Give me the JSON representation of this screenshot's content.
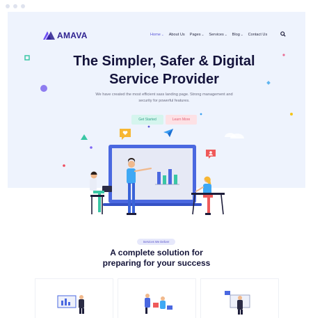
{
  "brand": {
    "logo_text": "AMAVA",
    "accent": "#5b57d9",
    "logo_color": "#2c1f8f"
  },
  "nav": {
    "items": [
      {
        "label": "Home",
        "dropdown": true,
        "active": true
      },
      {
        "label": "About Us",
        "dropdown": false
      },
      {
        "label": "Pages",
        "dropdown": true
      },
      {
        "label": "Services",
        "dropdown": true
      },
      {
        "label": "Blog",
        "dropdown": true
      },
      {
        "label": "Contact Us",
        "dropdown": false
      }
    ],
    "search_icon": "search-icon"
  },
  "hero": {
    "title_line1": "The Simpler, Safer & Digital",
    "title_line2": "Service Provider",
    "subtitle": "We have created the most efficient sass landing page. Strong management and security for powerful features.",
    "primary_button": "Get Started",
    "secondary_button": "Learn More",
    "background": "#eef3fd"
  },
  "services": {
    "badge": "Services We Deliver",
    "title_line1": "A complete solution for",
    "title_line2": "preparing for your success"
  }
}
